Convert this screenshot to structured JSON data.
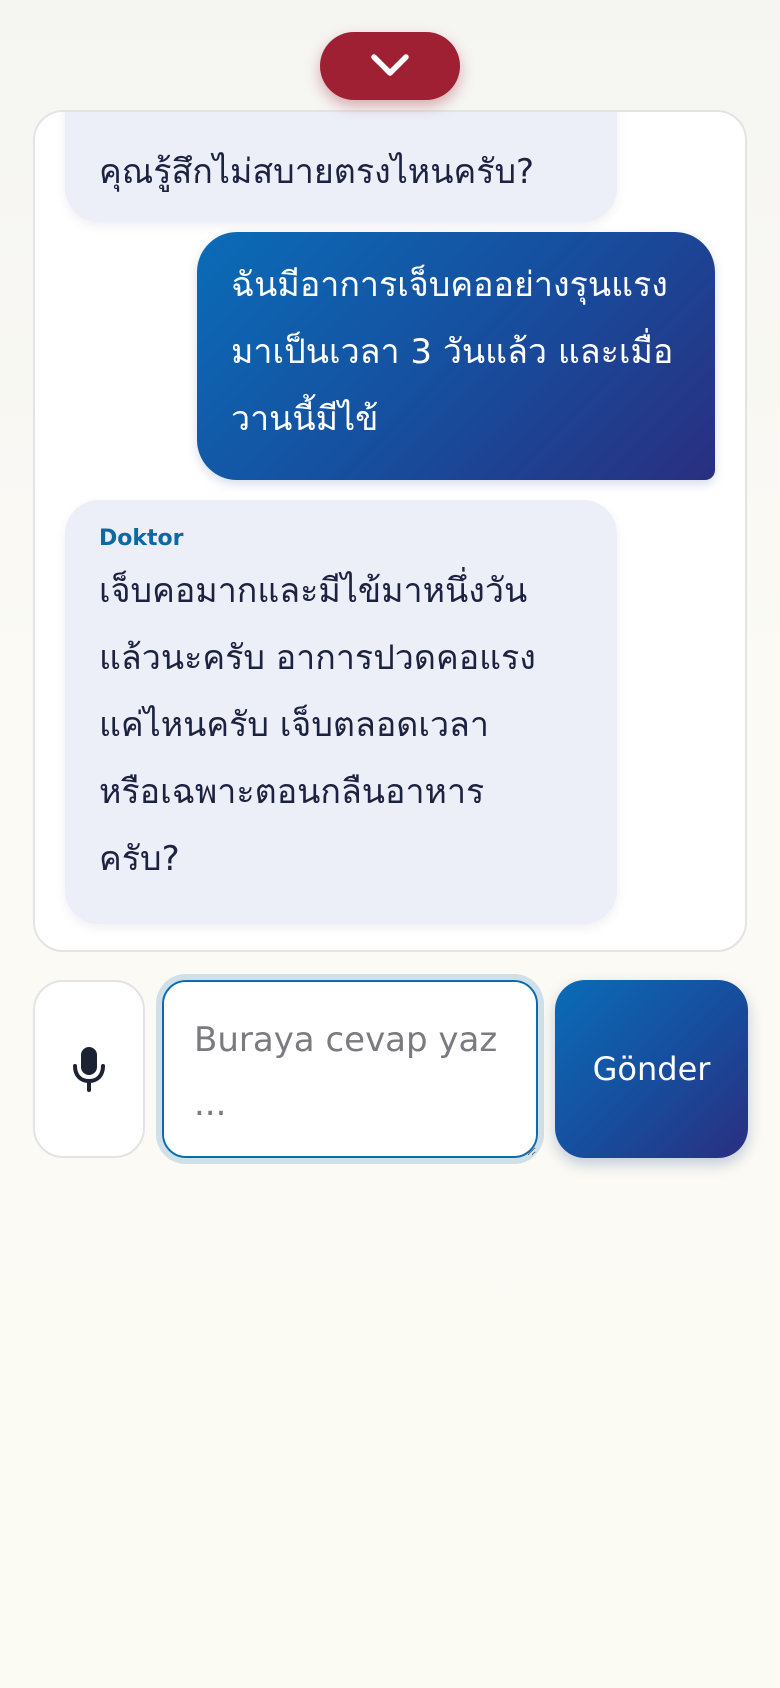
{
  "collapse_button": {
    "icon": "chevron-down-icon",
    "color": "#9f1f33"
  },
  "chat": {
    "messages": [
      {
        "role": "doctor",
        "sender": "",
        "text": "คุณรู้สึกไม่สบายตรงไหนครับ?"
      },
      {
        "role": "user",
        "text": "ฉันมีอาการเจ็บคออย่างรุนแรง\nมาเป็นเวลา 3 วันแล้ว และเมื่อ\nวานนี้มีไข้"
      },
      {
        "role": "doctor",
        "sender": "Doktor",
        "text": "เจ็บคอมากและมีไข้มาหนึ่งวัน\nแล้วนะครับ อาการปวดคอแรง\nแค่ไหนครับ เจ็บตลอดเวลา\nหรือเฉพาะตอนกลืนอาหาร\nครับ?"
      }
    ]
  },
  "composer": {
    "mic_icon": "microphone-icon",
    "input_value": "",
    "input_placeholder": "Buraya cevap yaz ...",
    "send_label": "Gönder"
  },
  "colors": {
    "accent_red": "#9f1f33",
    "accent_blue": "#0a6cb7",
    "accent_navy": "#2a2f80",
    "doctor_bubble": "#eceff8",
    "sender_label": "#0b6aa3"
  }
}
